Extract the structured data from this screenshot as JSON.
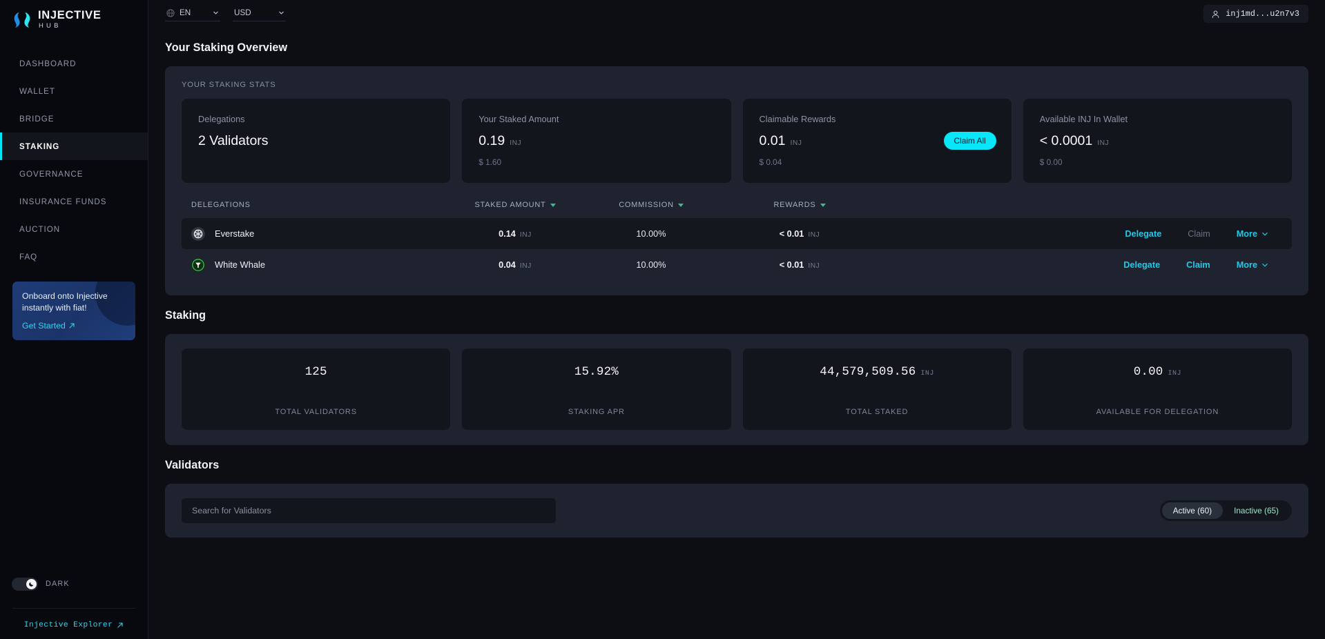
{
  "brand": {
    "title": "INJECTIVE",
    "subtitle": "HUB",
    "logo_icon": "injective-logo-icon"
  },
  "sidebar": {
    "items": [
      {
        "label": "DASHBOARD",
        "active": false
      },
      {
        "label": "WALLET",
        "active": false
      },
      {
        "label": "BRIDGE",
        "active": false
      },
      {
        "label": "STAKING",
        "active": true
      },
      {
        "label": "GOVERNANCE",
        "active": false
      },
      {
        "label": "INSURANCE FUNDS",
        "active": false
      },
      {
        "label": "AUCTION",
        "active": false
      },
      {
        "label": "FAQ",
        "active": false
      }
    ],
    "promo": {
      "text": "Onboard onto Injective instantly with fiat!",
      "link": "Get Started",
      "link_icon": "external-link-arrow-icon"
    },
    "theme": {
      "label": "DARK",
      "icon": "moon-icon",
      "enabled": true
    },
    "explorer": {
      "label": "Injective Explorer",
      "icon": "external-link-arrow-icon"
    }
  },
  "topbar": {
    "language": {
      "value": "EN",
      "icon": "globe-icon",
      "chevron": "chevron-down-icon"
    },
    "currency": {
      "value": "USD",
      "chevron": "chevron-down-icon"
    },
    "wallet": {
      "address": "inj1md...u2n7v3",
      "icon": "user-icon"
    }
  },
  "overview": {
    "heading": "Your Staking Overview",
    "panel_label": "YOUR STAKING STATS",
    "cards": [
      {
        "name": "Delegations",
        "value": "2 Validators",
        "unit": "",
        "sub": ""
      },
      {
        "name": "Your Staked Amount",
        "value": "0.19",
        "unit": "INJ",
        "sub": "$ 1.60"
      },
      {
        "name": "Claimable Rewards",
        "value": "0.01",
        "unit": "INJ",
        "sub": "$ 0.04",
        "action": "Claim All"
      },
      {
        "name": "Available INJ In Wallet",
        "value": "< 0.0001",
        "unit": "INJ",
        "sub": "$ 0.00"
      }
    ],
    "table": {
      "columns": [
        {
          "label": "DELEGATIONS",
          "sortable": false
        },
        {
          "label": "STAKED AMOUNT",
          "sortable": true
        },
        {
          "label": "COMMISSION",
          "sortable": true
        },
        {
          "label": "REWARDS",
          "sortable": true
        }
      ],
      "rows": [
        {
          "validator": "Everstake",
          "icon": "everstake-avatar-icon",
          "icon_color": "#3C4049",
          "staked": "0.14",
          "staked_unit": "INJ",
          "commission": "10.00%",
          "rewards": "< 0.01",
          "rewards_unit": "INJ",
          "delegate": "Delegate",
          "claim": "Claim",
          "claim_enabled": false,
          "more": "More",
          "hovered": true
        },
        {
          "validator": "White Whale",
          "icon": "white-whale-avatar-icon",
          "icon_color": "#1D4A24",
          "staked": "0.04",
          "staked_unit": "INJ",
          "commission": "10.00%",
          "rewards": "< 0.01",
          "rewards_unit": "INJ",
          "delegate": "Delegate",
          "claim": "Claim",
          "claim_enabled": true,
          "more": "More",
          "hovered": false
        }
      ]
    }
  },
  "staking": {
    "heading": "Staking",
    "metrics": [
      {
        "value": "125",
        "unit": "",
        "label": "TOTAL VALIDATORS"
      },
      {
        "value": "15.92%",
        "unit": "",
        "label": "STAKING APR"
      },
      {
        "value": "44,579,509.56",
        "unit": "INJ",
        "label": "TOTAL STAKED"
      },
      {
        "value": "0.00",
        "unit": "INJ",
        "label": "AVAILABLE FOR DELEGATION"
      }
    ]
  },
  "validators": {
    "heading": "Validators",
    "search_placeholder": "Search for Validators",
    "search_value": "",
    "filters": [
      {
        "label": "Active (60)",
        "selected": true
      },
      {
        "label": "Inactive (65)",
        "selected": false
      }
    ]
  },
  "colors": {
    "accent_cyan": "#08E6FA",
    "link_cyan": "#22C9E8",
    "sort_green": "#3EB795",
    "panel_bg": "#1F2330",
    "card_bg": "#13151D",
    "page_bg": "#0C0E14"
  }
}
